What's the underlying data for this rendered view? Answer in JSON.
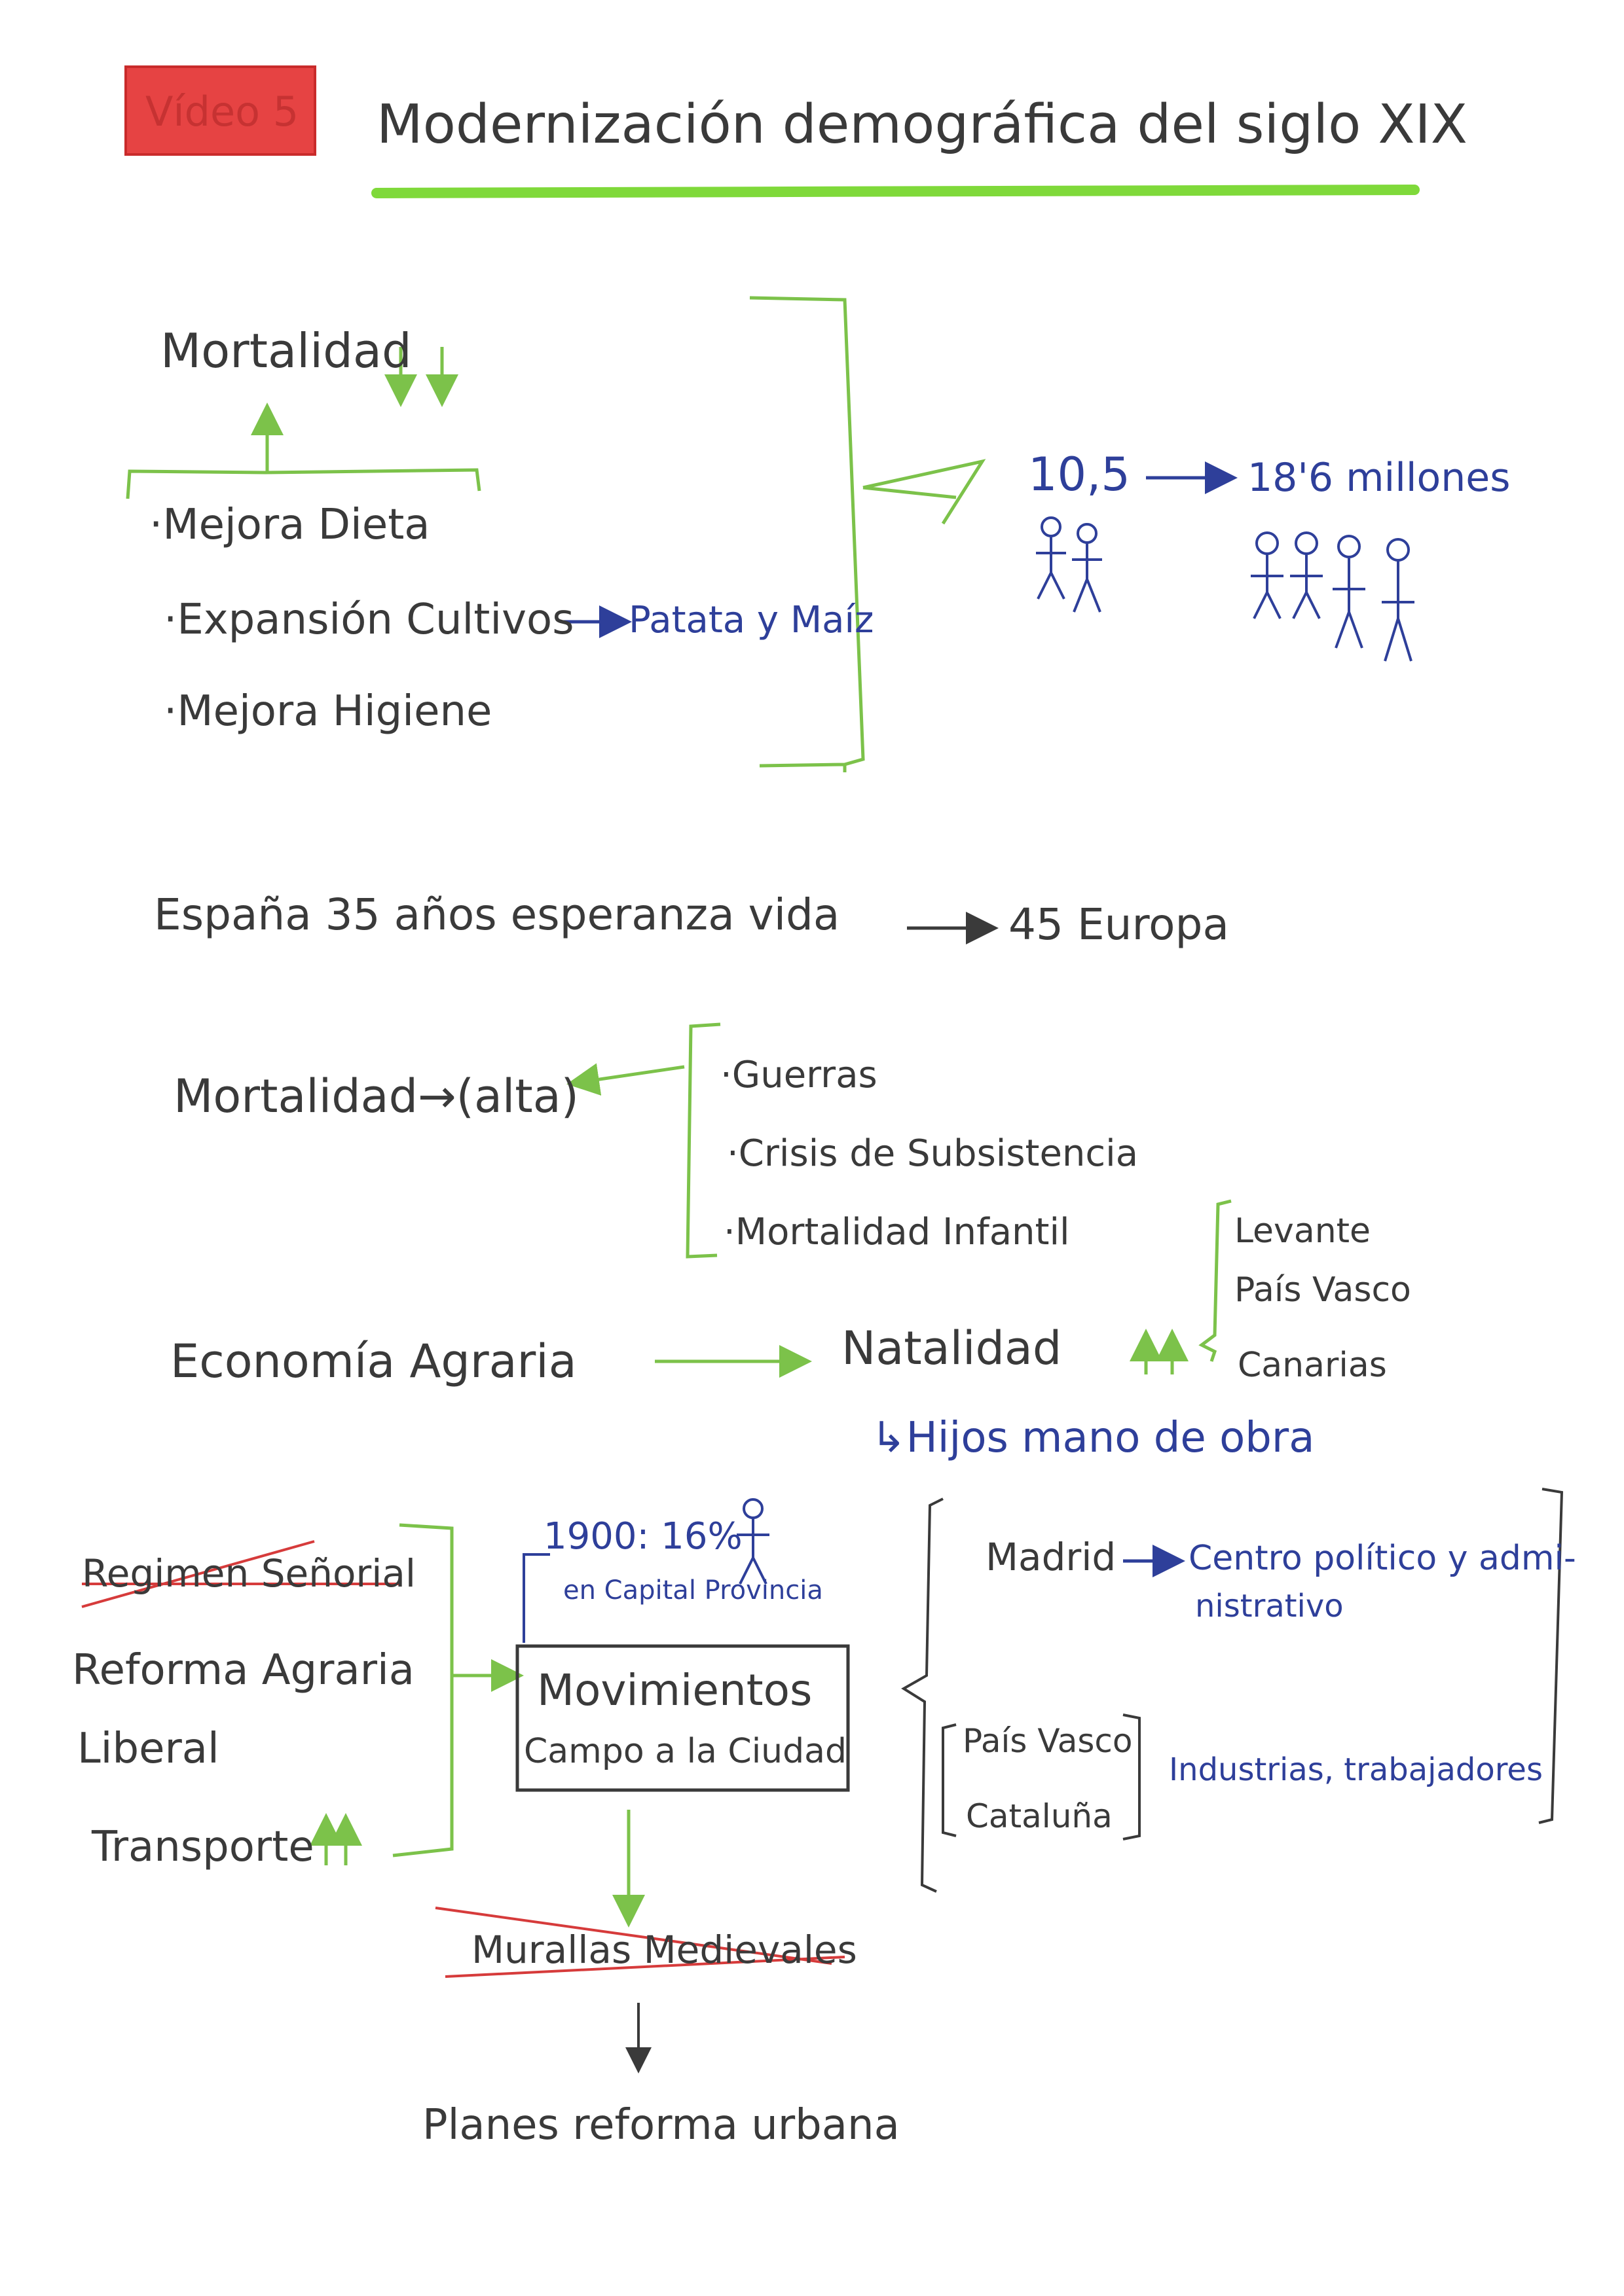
{
  "header": {
    "stamp_text": "Vídeo 5",
    "title": "Modernización demográfica del siglo XIX"
  },
  "section1": {
    "heading": "Mortalidad",
    "causes": [
      "·Mejora Dieta",
      "·Expansión Cultivos",
      "·Mejora Higiene"
    ],
    "crops": "Patata y Maíz",
    "pop_from": "10,5",
    "pop_to": "18'6 millones"
  },
  "section2": {
    "life_expectancy_spain": "España 35 años esperanza vida",
    "life_expectancy_europe": "45 Europa"
  },
  "section3": {
    "mortality_high": "Mortalidad→(alta)",
    "causes": [
      "·Guerras",
      "·Crisis de Subsistencia",
      "·Mortalidad Infantil"
    ],
    "regions": [
      "Levante",
      "País Vasco",
      "Canarias"
    ]
  },
  "section4": {
    "economy": "Economía Agraria",
    "natality": "Natalidad",
    "children": "↳Hijos mano de obra"
  },
  "section5": {
    "factors": [
      "Regimen Señorial",
      "Reforma Agraria",
      "Liberal",
      "Transporte"
    ],
    "stat_line1": "1900: 16%",
    "stat_line2": "en Capital Provincia",
    "movement_line1": "Movimientos",
    "movement_line2": "Campo a la Ciudad",
    "walls": "Murallas Medievales",
    "plans": "Planes reforma urbana",
    "madrid": "Madrid",
    "madrid_desc_line1": "Centro político y admi-",
    "madrid_desc_line2": "nistrativo",
    "north_regions": [
      "País Vasco",
      "Cataluña"
    ],
    "north_desc": "Industrias, trabajadores"
  },
  "colors": {
    "ink_gray": "#3a3a3a",
    "ink_blue": "#2e3f9a",
    "ink_green": "#7cc24a",
    "ink_red": "#d63b3b",
    "highlight": "#7fd93a"
  }
}
